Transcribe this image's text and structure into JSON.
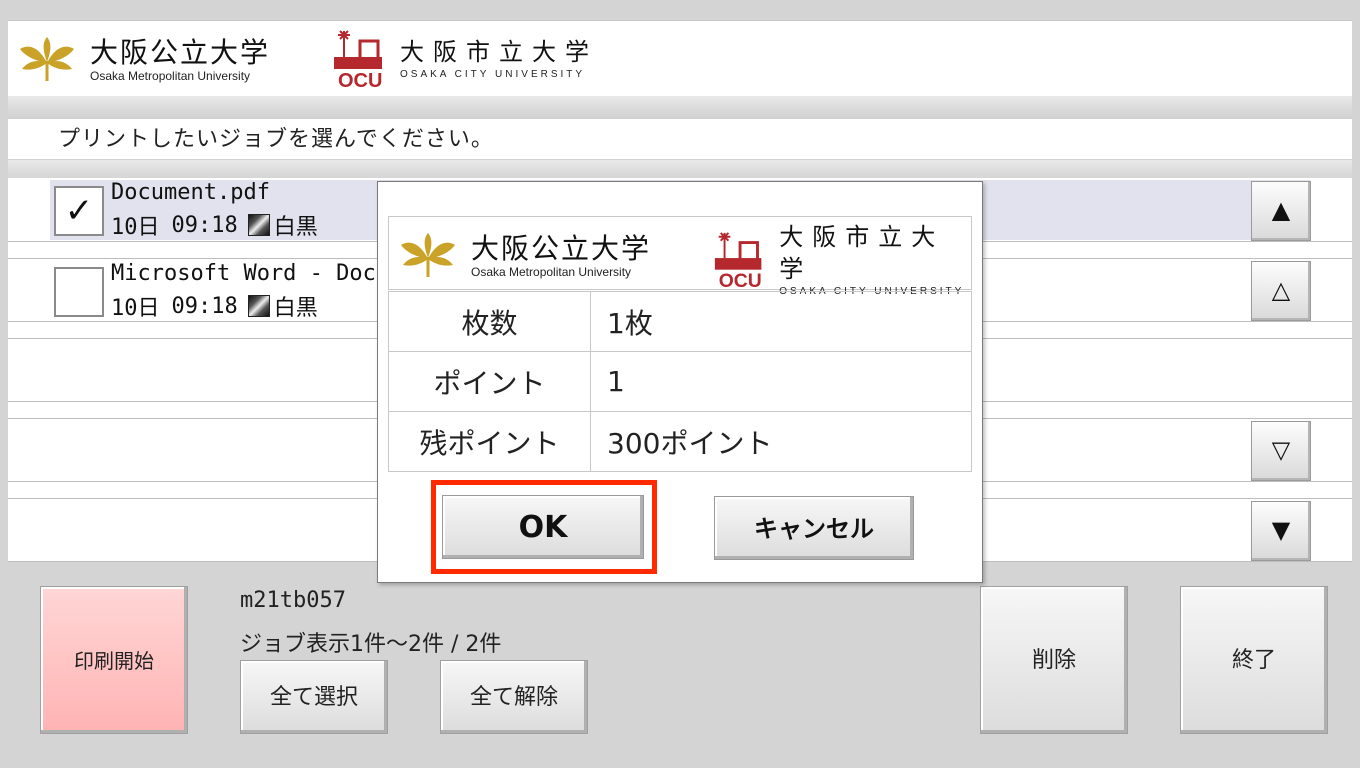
{
  "header": {
    "omu_name_jp": "大阪公立大学",
    "omu_name_en": "Osaka Metropolitan University",
    "ocu_name_jp": "大阪市立大学",
    "ocu_name_en": "OSAKA CITY UNIVERSITY"
  },
  "instruction": "プリントしたいジョブを選んでください。",
  "jobs": [
    {
      "name": "Document.pdf",
      "date": "10日",
      "time": "09:18",
      "color_mode": "白黒",
      "checked": true,
      "check_mark": "✓"
    },
    {
      "name": "Microsoft Word - Docu",
      "date": "10日",
      "time": "09:18",
      "color_mode": "白黒",
      "checked": false,
      "check_mark": ""
    }
  ],
  "scroll": {
    "top": "▲",
    "page_up": "△",
    "page_down": "▽",
    "bottom": "▼"
  },
  "bottom": {
    "print_label": "印刷開始",
    "user_id": "m21tb057",
    "job_count": "ジョブ表示1件～2件 / 2件",
    "select_all_label": "全て選択",
    "clear_all_label": "全て解除",
    "delete_label": "削除",
    "exit_label": "終了"
  },
  "dialog": {
    "rows": [
      {
        "label": "枚数",
        "value": "1枚"
      },
      {
        "label": "ポイント",
        "value": "1"
      },
      {
        "label": "残ポイント",
        "value": "300ポイント"
      }
    ],
    "ok_label": "OK",
    "cancel_label": "キャンセル"
  },
  "colors": {
    "omu_gold": "#c9a227",
    "ocu_red": "#b5282e",
    "highlight_red": "#ff2a00",
    "print_button": "#ffc0c0",
    "selected_row": "#e2e2ef"
  },
  "icons": {
    "omu_logo": "ginkgo-leaf-icon",
    "ocu_logo": "ocu-emblem-icon",
    "mono_print": "monochrome-icon"
  }
}
